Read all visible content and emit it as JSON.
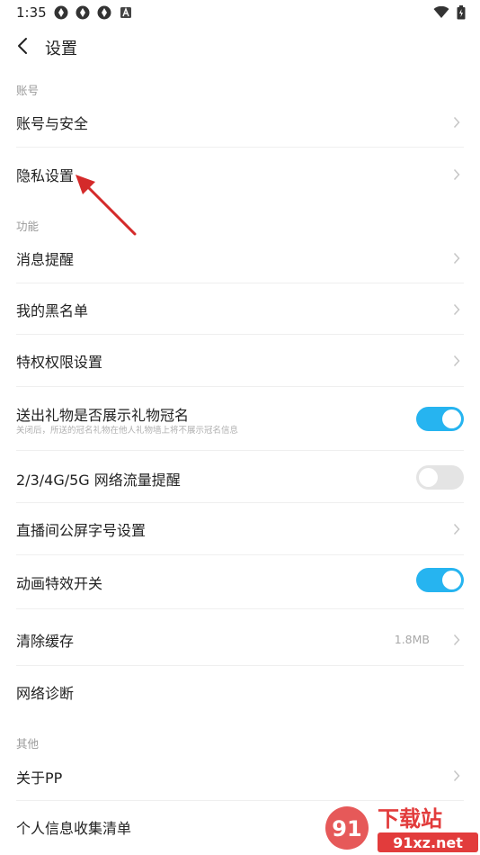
{
  "status_bar": {
    "time": "1:35",
    "icons": [
      "app-icon",
      "app-icon",
      "app-icon",
      "a-icon"
    ],
    "right_icons": [
      "wifi-icon",
      "battery-icon"
    ]
  },
  "header": {
    "title": "设置"
  },
  "sections": {
    "account": "账号",
    "features": "功能",
    "other": "其他"
  },
  "rows": {
    "account_security": "账号与安全",
    "privacy": "隐私设置",
    "notifications": "消息提醒",
    "blacklist": "我的黑名单",
    "permissions": "特权权限设置",
    "gift_crown": "送出礼物是否展示礼物冠名",
    "gift_crown_sub": "关闭后，所送的冠名礼物在他人礼物墙上将不展示冠名信息",
    "data_alert": "2/3/4G/5G 网络流量提醒",
    "font_size": "直播间公屏字号设置",
    "animation": "动画特效开关",
    "clear_cache": "清除缓存",
    "cache_size": "1.8MB",
    "network_diag": "网络诊断",
    "about": "关于PP",
    "personal_info": "个人信息收集清单"
  },
  "toggles": {
    "gift_crown": true,
    "data_alert": false,
    "animation": true
  },
  "colors": {
    "accent": "#26b4f0",
    "annotation_arrow": "#d42a2a",
    "watermark": "#e23c3c"
  },
  "watermark": {
    "site": "91xz.net",
    "text": "下载站",
    "logo": "91"
  }
}
